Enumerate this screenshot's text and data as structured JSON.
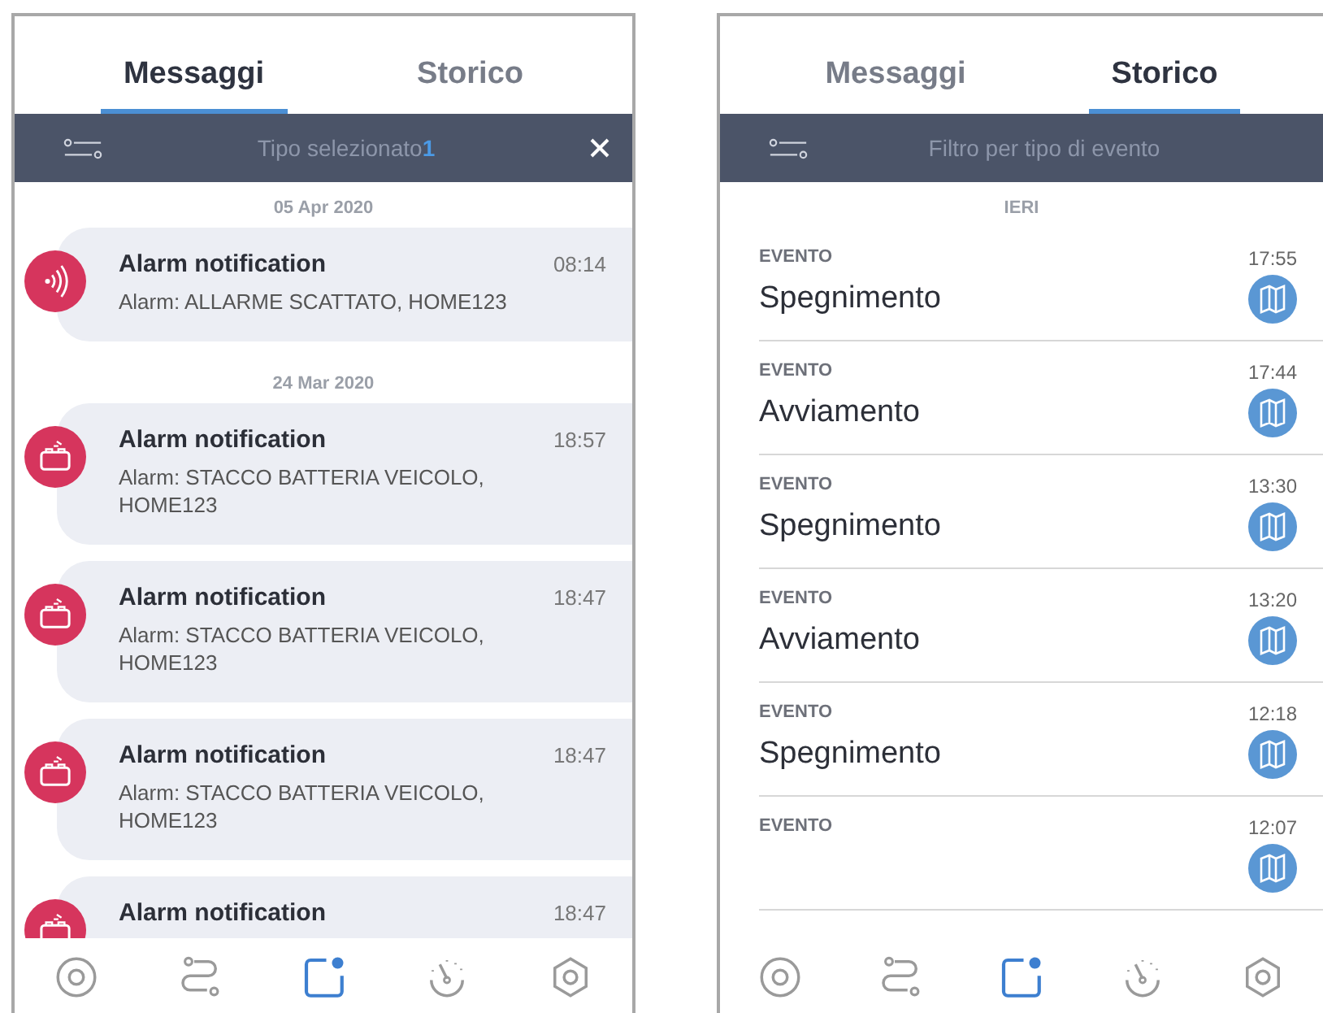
{
  "screens": [
    {
      "kind": "messages",
      "tabs": [
        {
          "label": "Messaggi",
          "selected": true
        },
        {
          "label": "Storico",
          "selected": false
        }
      ],
      "filter_bar": {
        "label": "Tipo selezionato",
        "count": "1",
        "clearable": true
      },
      "groups": [
        {
          "date": "05 Apr 2020",
          "messages": [
            {
              "kind": "signal",
              "title": "Alarm notification",
              "time": "08:14",
              "body": "Alarm: ALLARME SCATTATO, HOME123"
            }
          ]
        },
        {
          "date": "24 Mar 2020",
          "messages": [
            {
              "kind": "battery",
              "title": "Alarm notification",
              "time": "18:57",
              "body": "Alarm: STACCO BATTERIA VEICOLO, HOME123"
            },
            {
              "kind": "battery",
              "title": "Alarm notification",
              "time": "18:47",
              "body": "Alarm: STACCO BATTERIA VEICOLO, HOME123"
            },
            {
              "kind": "battery",
              "title": "Alarm notification",
              "time": "18:47",
              "body": "Alarm: STACCO BATTERIA VEICOLO, HOME123"
            },
            {
              "kind": "battery",
              "title": "Alarm notification",
              "time": "18:47"
            }
          ]
        }
      ],
      "nav": [
        {
          "kind": "target",
          "selected": false
        },
        {
          "kind": "route",
          "selected": false
        },
        {
          "kind": "messages",
          "selected": true
        },
        {
          "kind": "gauge",
          "selected": false
        },
        {
          "kind": "settings",
          "selected": false
        }
      ]
    },
    {
      "kind": "history",
      "tabs": [
        {
          "label": "Messaggi",
          "selected": false
        },
        {
          "label": "Storico",
          "selected": true
        }
      ],
      "filter_bar": {
        "placeholder": "Filtro per tipo di evento",
        "clearable": false
      },
      "groups": [
        {
          "date": "IERI",
          "events": [
            {
              "label": "EVENTO",
              "time": "17:55",
              "title": "Spegnimento"
            },
            {
              "label": "EVENTO",
              "time": "17:44",
              "title": "Avviamento"
            },
            {
              "label": "EVENTO",
              "time": "13:30",
              "title": "Spegnimento"
            },
            {
              "label": "EVENTO",
              "time": "13:20",
              "title": "Avviamento"
            },
            {
              "label": "EVENTO",
              "time": "12:18",
              "title": "Spegnimento"
            },
            {
              "label": "EVENTO",
              "time": "12:07"
            }
          ]
        }
      ],
      "nav": [
        {
          "kind": "target",
          "selected": false
        },
        {
          "kind": "route",
          "selected": false
        },
        {
          "kind": "messages",
          "selected": true
        },
        {
          "kind": "gauge",
          "selected": false
        },
        {
          "kind": "settings",
          "selected": false
        }
      ]
    }
  ]
}
